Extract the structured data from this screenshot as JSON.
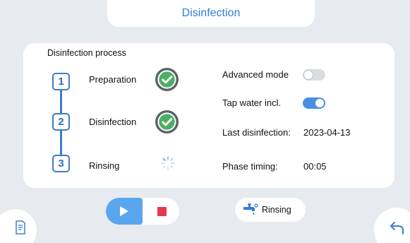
{
  "header": {
    "title": "Disinfection"
  },
  "process": {
    "title": "Disinfection process",
    "steps": [
      {
        "number": "1",
        "label": "Preparation",
        "status": "done"
      },
      {
        "number": "2",
        "label": "Disinfection",
        "status": "done"
      },
      {
        "number": "3",
        "label": "Rinsing",
        "status": "in-progress"
      }
    ]
  },
  "settings": {
    "advanced_mode_label": "Advanced mode",
    "advanced_mode_on": false,
    "tap_water_label": "Tap water incl.",
    "tap_water_on": true,
    "last_disinfection_label": "Last disinfection:",
    "last_disinfection_value": "2023-04-13",
    "phase_timing_label": "Phase timing:",
    "phase_timing_value": "00:05"
  },
  "controls": {
    "mode_label": "Rinsing"
  },
  "colors": {
    "accent": "#2f7ed8",
    "step_blue": "#3d7ec8",
    "check_green": "#4caf64",
    "stop_red": "#e23a4a",
    "play_blue": "#5aa6ee"
  },
  "icons": [
    "check-circle-icon",
    "spinner-icon",
    "play-icon",
    "stop-icon",
    "faucet-icon",
    "manual-icon",
    "back-arrow-icon"
  ]
}
